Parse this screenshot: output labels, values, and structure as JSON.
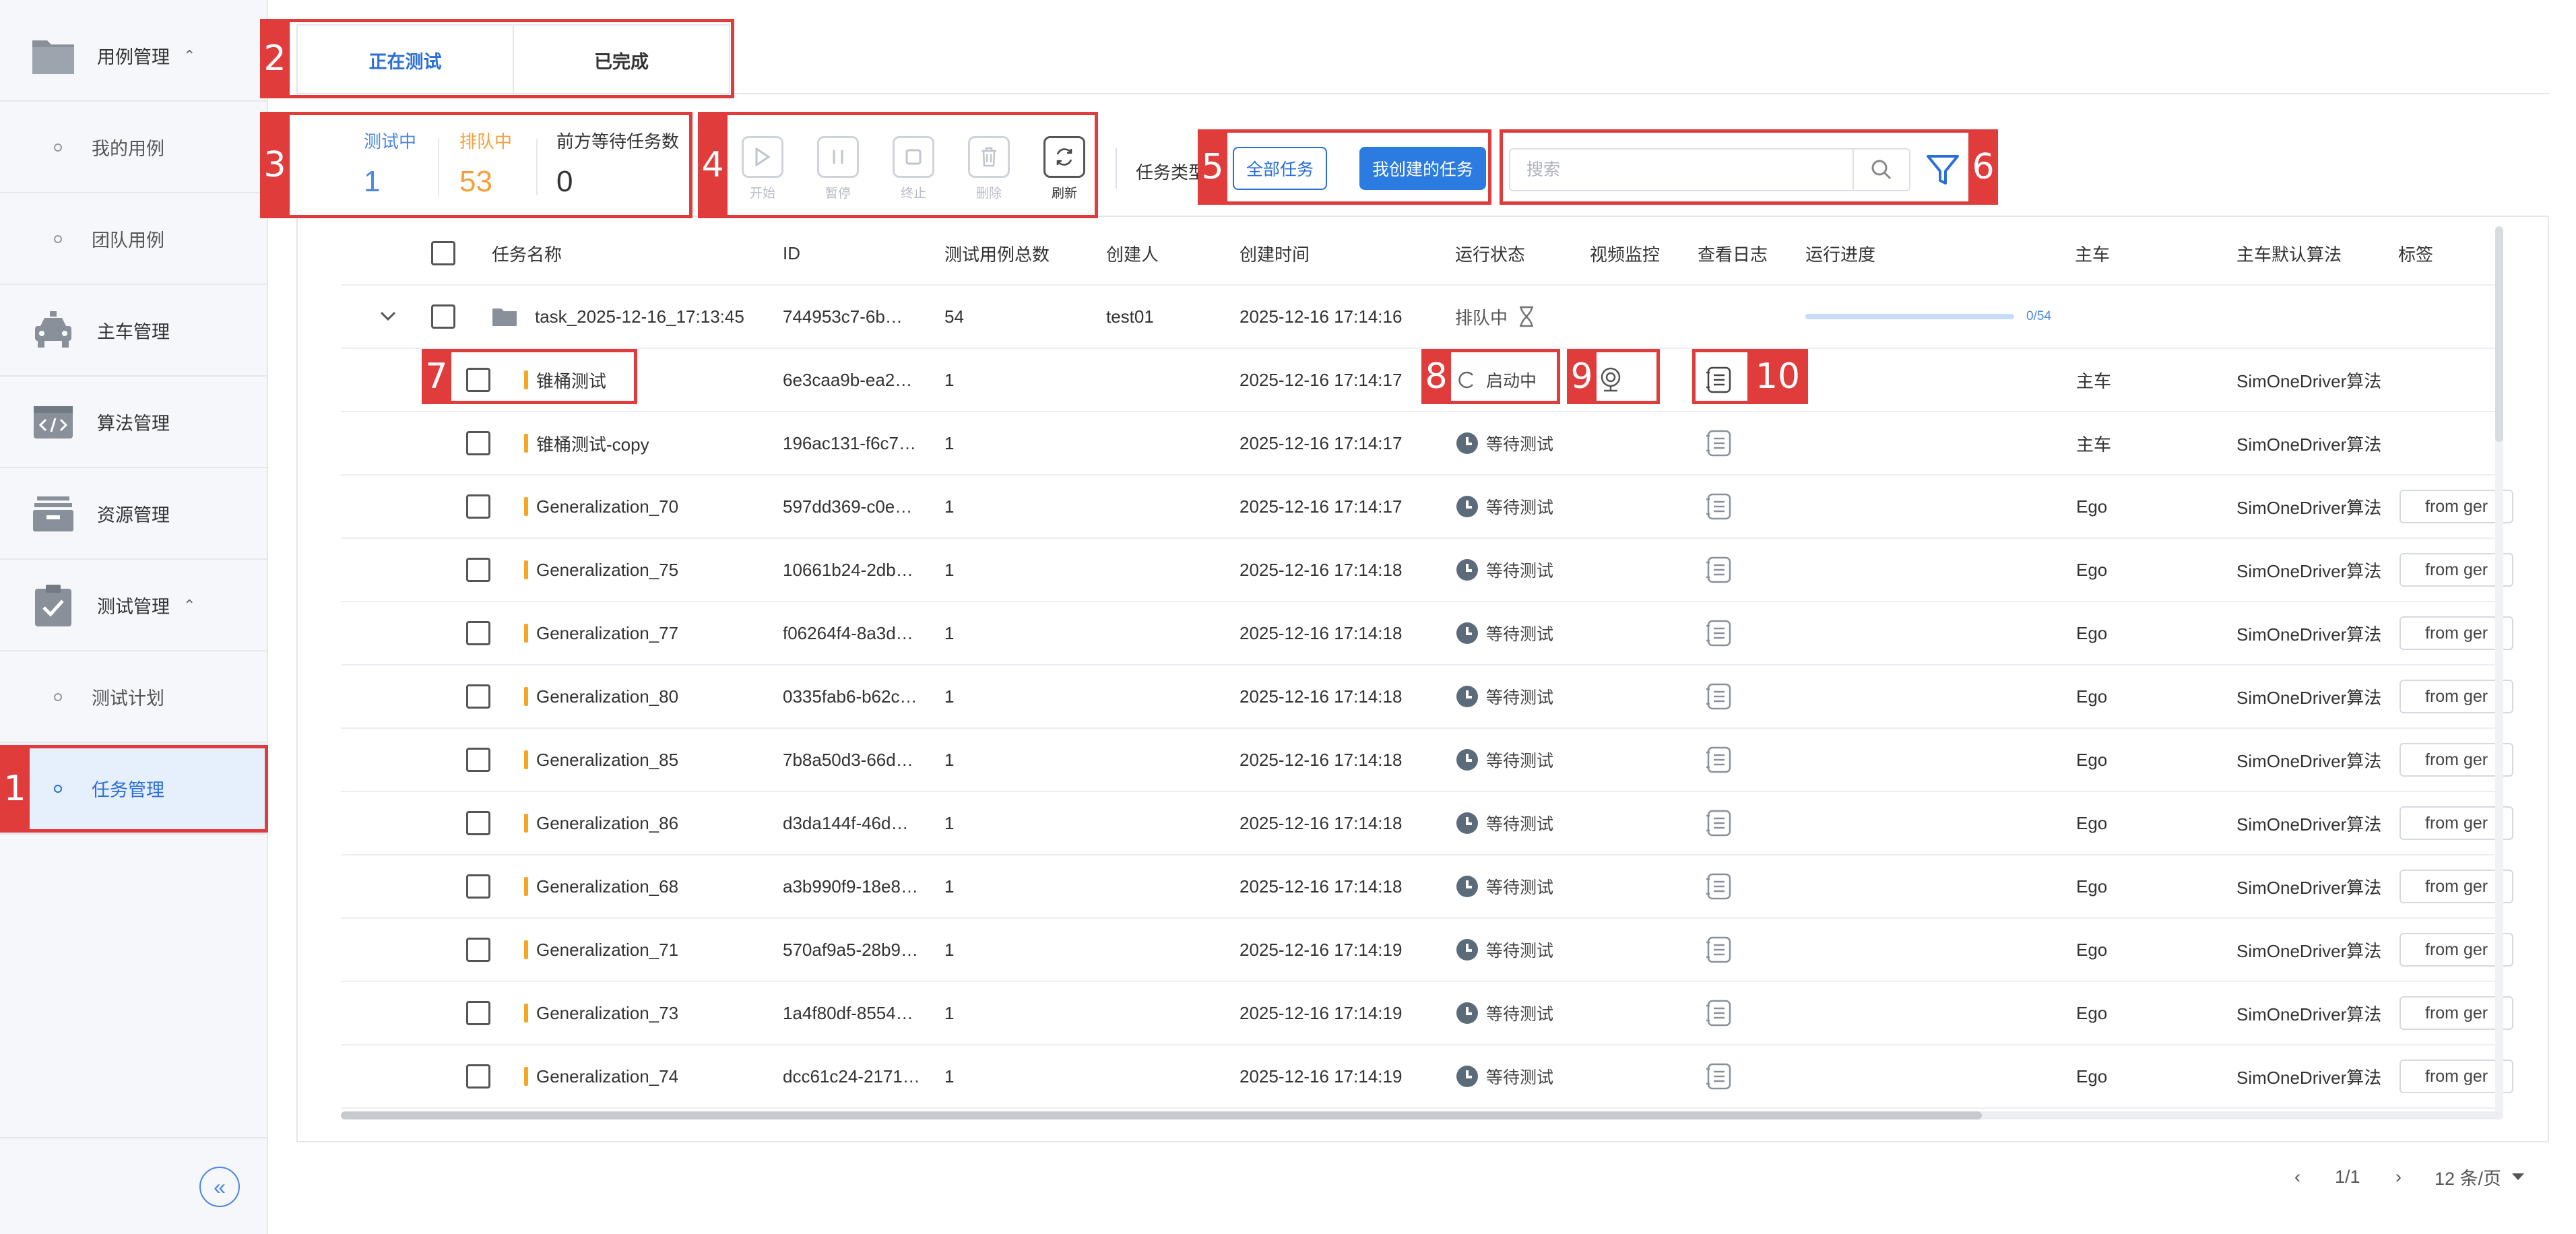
{
  "sidebar": {
    "items": [
      {
        "label": "用例管理",
        "icon": "folder-icon",
        "caret": "⌃"
      },
      {
        "label": "我的用例"
      },
      {
        "label": "团队用例"
      },
      {
        "label": "主车管理",
        "icon": "car-icon"
      },
      {
        "label": "算法管理",
        "icon": "code-icon"
      },
      {
        "label": "资源管理",
        "icon": "box-icon"
      },
      {
        "label": "测试管理",
        "icon": "clipboard-check-icon",
        "caret": "⌃"
      },
      {
        "label": "测试计划"
      },
      {
        "label": "任务管理"
      }
    ],
    "collapse_glyph": "«"
  },
  "tabs": [
    {
      "label": "正在测试"
    },
    {
      "label": "已完成"
    }
  ],
  "stats": {
    "testing": {
      "label": "测试中",
      "value": "1",
      "color": "#4b86e5"
    },
    "queued": {
      "label": "排队中",
      "value": "53",
      "color": "#f5a03c"
    },
    "waiting": {
      "label": "前方等待任务数",
      "value": "0"
    }
  },
  "toolbar": {
    "start": "开始",
    "pause": "暂停",
    "stop": "终止",
    "delete": "删除",
    "refresh": "刷新",
    "type_label": "任务类型",
    "all_tasks": "全部任务",
    "my_tasks": "我创建的任务",
    "search_placeholder": "搜索"
  },
  "table": {
    "headers": [
      "任务名称",
      "ID",
      "测试用例总数",
      "创建人",
      "创建时间",
      "运行状态",
      "视频监控",
      "查看日志",
      "运行进度",
      "主车",
      "主车默认算法",
      "标签"
    ],
    "group": {
      "name": "task_2025-12-16_17:13:45",
      "id": "744953c7-6b…",
      "total": "54",
      "creator": "test01",
      "time": "2025-12-16 17:14:16",
      "status": "排队中",
      "progress_text": "0/54"
    },
    "rows": [
      {
        "name": "锥桶测试",
        "id": "6e3caa9b-ea2…",
        "total": "1",
        "time": "2025-12-16 17:14:17",
        "status": "启动中",
        "car": "主车",
        "algo": "SimOneDriver算法",
        "tag": ""
      },
      {
        "name": "锥桶测试-copy",
        "id": "196ac131-f6c7…",
        "total": "1",
        "time": "2025-12-16 17:14:17",
        "status": "等待测试",
        "car": "主车",
        "algo": "SimOneDriver算法",
        "tag": ""
      },
      {
        "name": "Generalization_70",
        "id": "597dd369-c0e…",
        "total": "1",
        "time": "2025-12-16 17:14:17",
        "status": "等待测试",
        "car": "Ego",
        "algo": "SimOneDriver算法",
        "tag": "from ger"
      },
      {
        "name": "Generalization_75",
        "id": "10661b24-2db…",
        "total": "1",
        "time": "2025-12-16 17:14:18",
        "status": "等待测试",
        "car": "Ego",
        "algo": "SimOneDriver算法",
        "tag": "from ger"
      },
      {
        "name": "Generalization_77",
        "id": "f06264f4-8a3d…",
        "total": "1",
        "time": "2025-12-16 17:14:18",
        "status": "等待测试",
        "car": "Ego",
        "algo": "SimOneDriver算法",
        "tag": "from ger"
      },
      {
        "name": "Generalization_80",
        "id": "0335fab6-b62c…",
        "total": "1",
        "time": "2025-12-16 17:14:18",
        "status": "等待测试",
        "car": "Ego",
        "algo": "SimOneDriver算法",
        "tag": "from ger"
      },
      {
        "name": "Generalization_85",
        "id": "7b8a50d3-66d…",
        "total": "1",
        "time": "2025-12-16 17:14:18",
        "status": "等待测试",
        "car": "Ego",
        "algo": "SimOneDriver算法",
        "tag": "from ger"
      },
      {
        "name": "Generalization_86",
        "id": "d3da144f-46d…",
        "total": "1",
        "time": "2025-12-16 17:14:18",
        "status": "等待测试",
        "car": "Ego",
        "algo": "SimOneDriver算法",
        "tag": "from ger"
      },
      {
        "name": "Generalization_68",
        "id": "a3b990f9-18e8…",
        "total": "1",
        "time": "2025-12-16 17:14:18",
        "status": "等待测试",
        "car": "Ego",
        "algo": "SimOneDriver算法",
        "tag": "from ger"
      },
      {
        "name": "Generalization_71",
        "id": "570af9a5-28b9…",
        "total": "1",
        "time": "2025-12-16 17:14:19",
        "status": "等待测试",
        "car": "Ego",
        "algo": "SimOneDriver算法",
        "tag": "from ger"
      },
      {
        "name": "Generalization_73",
        "id": "1a4f80df-8554…",
        "total": "1",
        "time": "2025-12-16 17:14:19",
        "status": "等待测试",
        "car": "Ego",
        "algo": "SimOneDriver算法",
        "tag": "from ger"
      },
      {
        "name": "Generalization_74",
        "id": "dcc61c24-2171…",
        "total": "1",
        "time": "2025-12-16 17:14:19",
        "status": "等待测试",
        "car": "Ego",
        "algo": "SimOneDriver算法",
        "tag": "from ger"
      }
    ]
  },
  "pagination": {
    "prev": "‹",
    "page": "1/1",
    "next": "›",
    "page_size": "12 条/页"
  },
  "annotations": [
    "1",
    "2",
    "3",
    "4",
    "5",
    "6",
    "7",
    "8",
    "9",
    "10"
  ],
  "colors": {
    "primary": "#2b6fd6",
    "annotation": "#e03c3c",
    "queued": "#f5a03c",
    "tag_bar": "#f5a623"
  }
}
